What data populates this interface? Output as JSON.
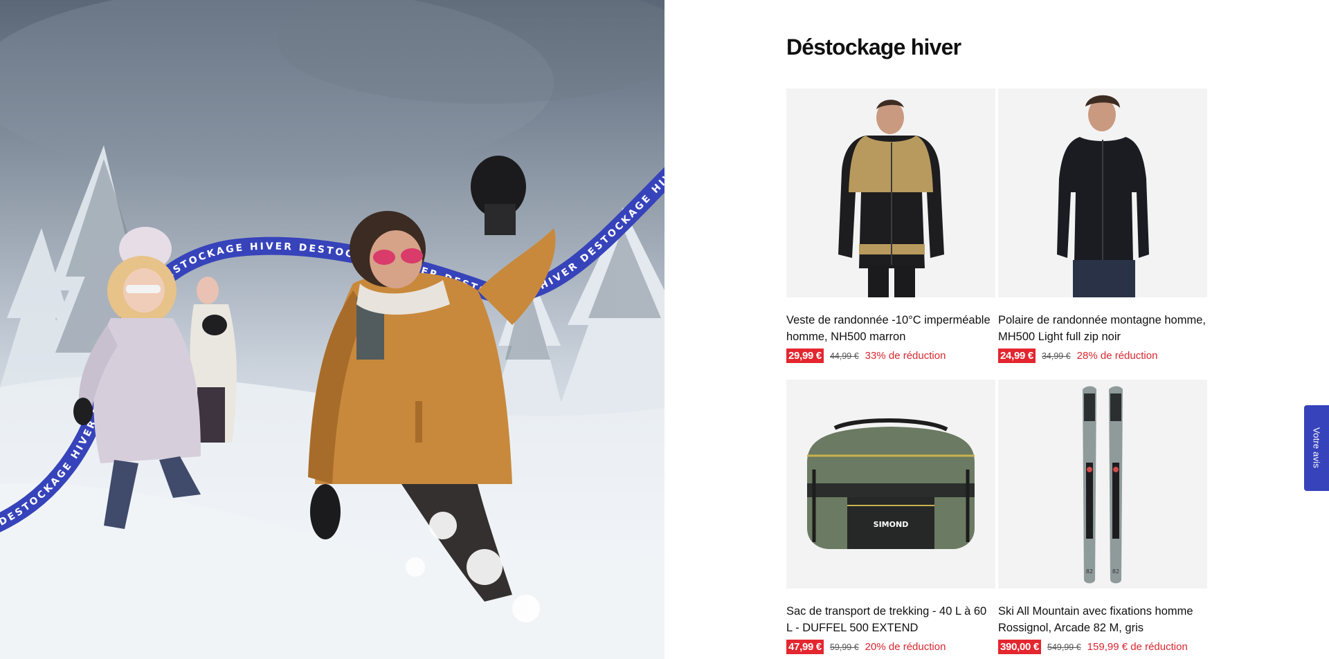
{
  "hero": {
    "banner_text": "DESTOCKAGE HIVER DESTOCKAGE HIVER DESTOCKAGE HIVER DESTOCKAGE HIVER DESTOCKAGE HIVER DESTOCKAGE HIVER"
  },
  "section": {
    "title": "Déstockage hiver"
  },
  "products": [
    {
      "name": "Veste de randonnée -10°C imperméable homme, NH500 marron",
      "price": "29,99 €",
      "old_price": "44,99 €",
      "discount": "33% de réduction"
    },
    {
      "name": "Polaire de randonnée montagne homme, MH500 Light full zip noir",
      "price": "24,99 €",
      "old_price": "34,99 €",
      "discount": "28% de réduction"
    },
    {
      "name": "Sac de transport de trekking - 40 L à 60 L - DUFFEL 500 EXTEND",
      "price": "47,99 €",
      "old_price": "59,99 €",
      "discount": "20% de réduction",
      "brand_on_bag": "SIMOND"
    },
    {
      "name": "Ski All Mountain avec fixations homme Rossignol, Arcade 82 M, gris",
      "price": "390,00 €",
      "old_price": "549,99 €",
      "discount": "159,99 € de réduction",
      "ski_label": "82"
    }
  ],
  "feedback": {
    "label": "Votre avis"
  },
  "colors": {
    "accent_blue": "#3643ba",
    "price_red": "#e3262f",
    "discount_red": "#d9252e"
  }
}
